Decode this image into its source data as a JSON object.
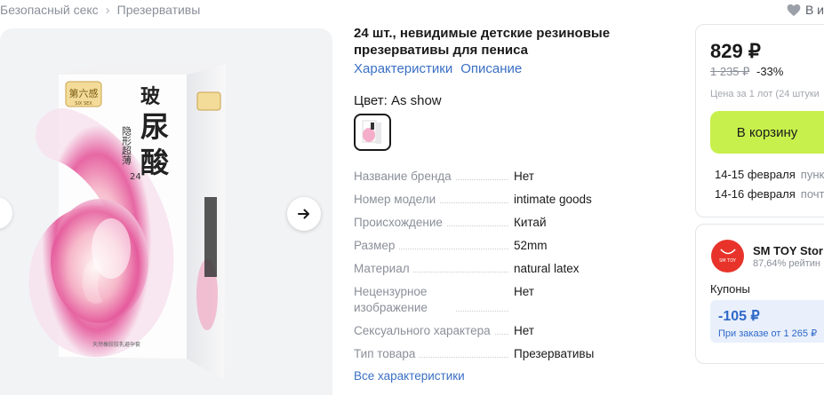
{
  "breadcrumb": {
    "items": [
      "Безопасный секс",
      "Презервативы"
    ],
    "separator": "›"
  },
  "favorite": {
    "label": "В и"
  },
  "product": {
    "title": "24 шт., невидимые детские резиновые презервативы для пениса",
    "links": [
      "Характеристики",
      "Описание"
    ],
    "color_label": "Цвет: As show",
    "package_text": {
      "brand_cn": "第六感",
      "brand_en": "SIX SEX",
      "line1": "隐形超薄",
      "count": "24",
      "main": [
        "玻",
        "尿",
        "酸"
      ],
      "bottom": "天然橡胶胶乳避孕套"
    }
  },
  "specs": [
    {
      "name": "Название бренда",
      "value": "Нет"
    },
    {
      "name": "Номер модели",
      "value": "intimate goods"
    },
    {
      "name": "Происхождение",
      "value": "Китай"
    },
    {
      "name": "Размер",
      "value": "52mm"
    },
    {
      "name": "Материал",
      "value": "natural latex"
    },
    {
      "name": "Нецензурное изображение",
      "value": "Нет"
    },
    {
      "name": "Сексуального характера",
      "value": "Нет"
    },
    {
      "name": "Тип товара",
      "value": "Презервативы"
    }
  ],
  "all_specs_label": "Все характеристики",
  "price_block": {
    "price": "829 ₽",
    "old_price": "1 235 ₽",
    "discount": "-33%",
    "per_lot": "Цена за 1 лот (24 штуки",
    "cart_button": "В корзину",
    "delivery": [
      {
        "date": "14-15 февраля",
        "type": "пунк"
      },
      {
        "date": "14-16 февраля",
        "type": "почт"
      }
    ]
  },
  "seller": {
    "logo_text": "SM TOY",
    "name": "SM TOY Stor",
    "rating": "87,64% рейтин",
    "coupons_label": "Купоны",
    "coupon_value": "-105 ₽",
    "coupon_condition": "При заказе от 1 265 ₽"
  },
  "colors": {
    "accent_green": "#c7f04c",
    "link_blue": "#3a6fc4",
    "coupon_blue": "#2f68c8",
    "store_red": "#e8332a"
  }
}
